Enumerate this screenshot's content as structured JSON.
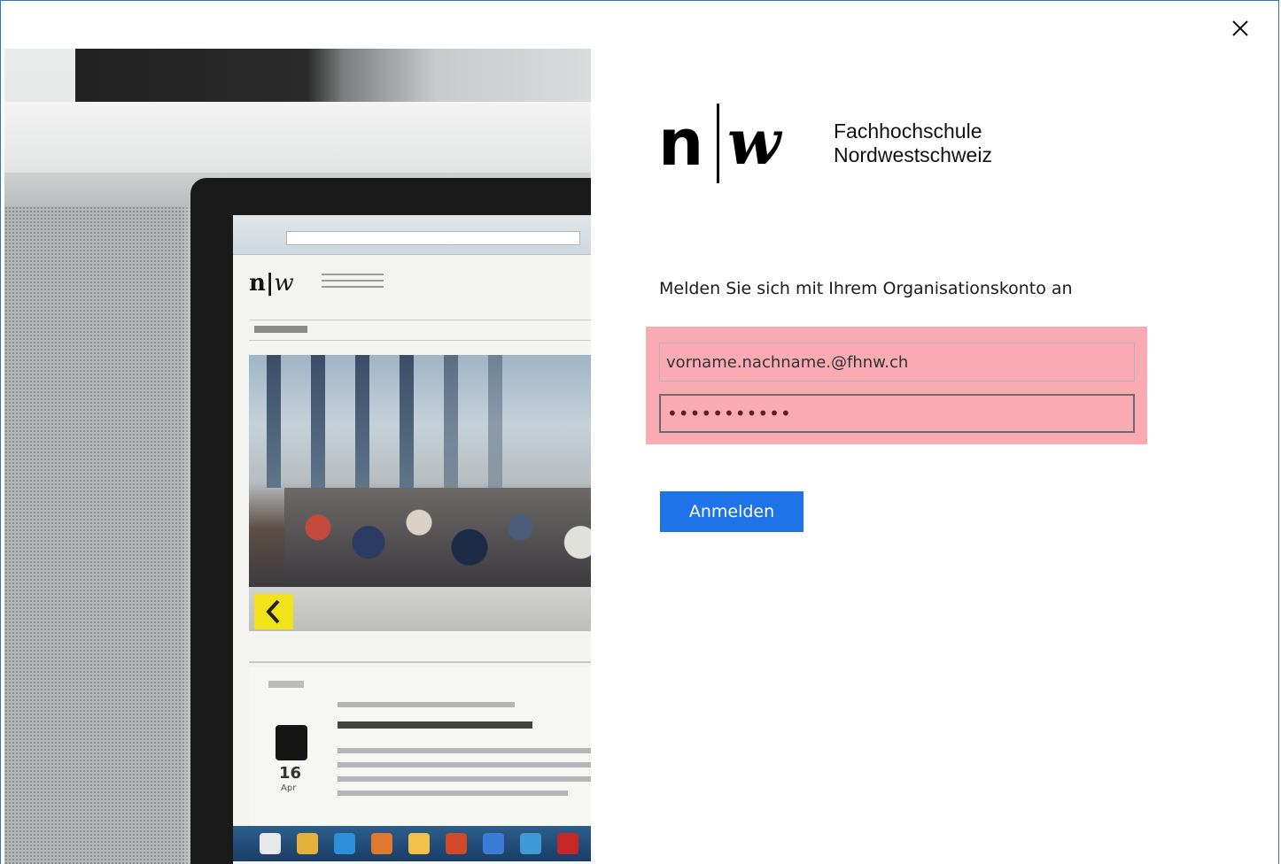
{
  "dialog": {
    "close_icon": "close-icon"
  },
  "logo": {
    "mark_n": "n",
    "mark_w": "w",
    "org_line1": "Fachhochschule",
    "org_line2": "Nordwestschweiz"
  },
  "signin": {
    "prompt": "Melden Sie sich mit Ihrem Organisationskonto an",
    "username_value": "vorname.nachname.@fhnw.ch",
    "password_masked": "•••••••••••",
    "submit_label": "Anmelden"
  },
  "colors": {
    "highlight": "#f9aab3",
    "button": "#1e73e8",
    "dialog_border": "#2b78c5"
  }
}
